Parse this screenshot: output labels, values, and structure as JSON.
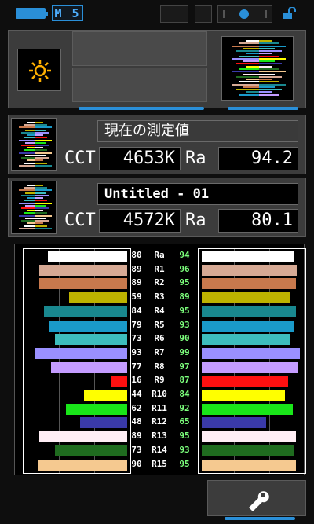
{
  "status_bar": {
    "mode": "M 5",
    "battery_icon": "battery-icon",
    "lock_icon": "unlock-icon"
  },
  "top_panel": {
    "sun_icon": "sun-icon",
    "spectrum_icon": "spectrum-thumbnail"
  },
  "current": {
    "title": "現在の測定値",
    "cct_label": "CCT",
    "cct_value": "4653K",
    "ra_label": "Ra",
    "ra_value": "94.2"
  },
  "saved": {
    "title": "Untitled - 01",
    "cct_label": "CCT",
    "cct_value": "4572K",
    "ra_label": "Ra",
    "ra_value": "80.1"
  },
  "cri": {
    "rows": [
      {
        "label": "Ra",
        "left": "80",
        "right": "94",
        "color": "#ffffff"
      },
      {
        "label": "R1",
        "left": "89",
        "right": "96",
        "color": "#d6a994"
      },
      {
        "label": "R2",
        "left": "89",
        "right": "95",
        "color": "#c8794d"
      },
      {
        "label": "R3",
        "left": "59",
        "right": "89",
        "color": "#bdb300"
      },
      {
        "label": "R4",
        "left": "84",
        "right": "95",
        "color": "#19888f"
      },
      {
        "label": "R5",
        "left": "79",
        "right": "93",
        "color": "#1a9ac9"
      },
      {
        "label": "R6",
        "left": "73",
        "right": "90",
        "color": "#3dbdbd"
      },
      {
        "label": "R7",
        "left": "93",
        "right": "99",
        "color": "#9a90ff"
      },
      {
        "label": "R8",
        "left": "77",
        "right": "97",
        "color": "#c49cff"
      },
      {
        "label": "R9",
        "left": "16",
        "right": "87",
        "color": "#ff1010"
      },
      {
        "label": "R10",
        "left": "44",
        "right": "84",
        "color": "#ffff00"
      },
      {
        "label": "R11",
        "left": "62",
        "right": "92",
        "color": "#19e619"
      },
      {
        "label": "R12",
        "left": "48",
        "right": "65",
        "color": "#3a3aa8"
      },
      {
        "label": "R13",
        "left": "89",
        "right": "95",
        "color": "#ffeef5"
      },
      {
        "label": "R14",
        "left": "73",
        "right": "93",
        "color": "#1f6b1f"
      },
      {
        "label": "R15",
        "left": "90",
        "right": "95",
        "color": "#f5c990"
      }
    ]
  },
  "footer": {
    "wrench_icon": "wrench-icon"
  },
  "colors": {
    "accent": "#2a8fd8",
    "panel": "#3c3c3c",
    "right_value": "#7cff7c"
  }
}
